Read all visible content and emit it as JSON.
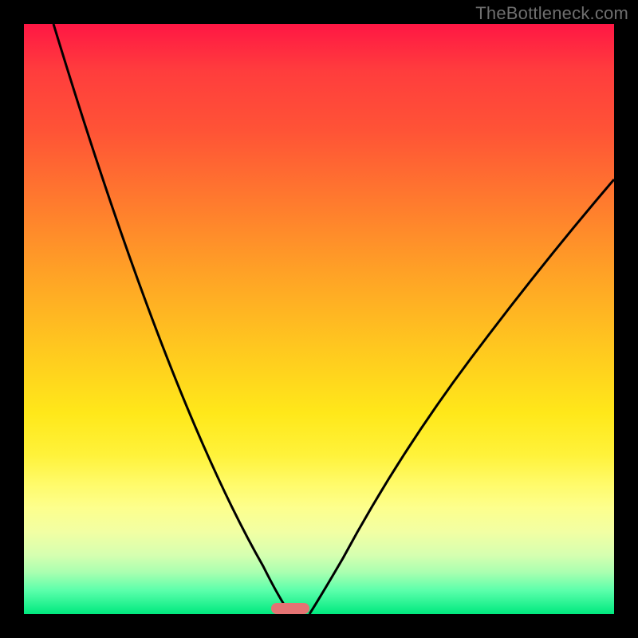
{
  "watermark": "TheBottleneck.com",
  "chart_data": {
    "type": "line",
    "title": "",
    "xlabel": "",
    "ylabel": "",
    "xlim": [
      0,
      100
    ],
    "ylim": [
      0,
      100
    ],
    "series": [
      {
        "name": "left-curve",
        "x": [
          5,
          10,
          15,
          20,
          25,
          30,
          35,
          40,
          42,
          44,
          45,
          46
        ],
        "y": [
          100,
          90,
          79,
          67,
          55,
          42,
          29,
          15,
          8,
          3,
          1,
          0
        ]
      },
      {
        "name": "right-curve",
        "x": [
          48,
          49,
          50,
          52,
          55,
          60,
          65,
          70,
          75,
          80,
          85,
          90,
          95,
          100
        ],
        "y": [
          0,
          1,
          3,
          7,
          14,
          24,
          33,
          41,
          48,
          54,
          60,
          65,
          70,
          74
        ]
      }
    ],
    "marker": {
      "x": 46,
      "width": 6
    },
    "annotations": []
  }
}
